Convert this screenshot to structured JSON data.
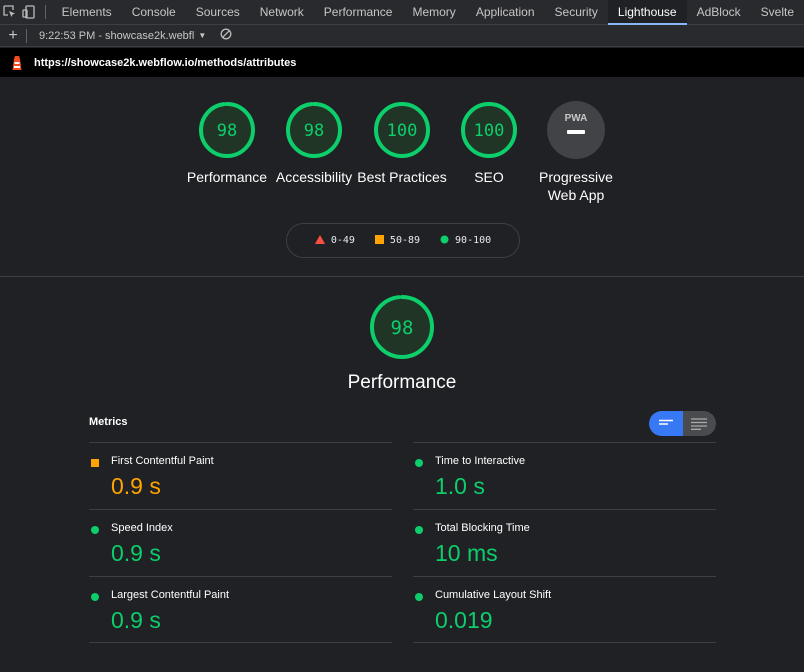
{
  "devtools": {
    "tabs": [
      "Elements",
      "Console",
      "Sources",
      "Network",
      "Performance",
      "Memory",
      "Application",
      "Security",
      "Lighthouse",
      "AdBlock",
      "Svelte"
    ],
    "active_tab": "Lighthouse"
  },
  "toolbar": {
    "report_label": "9:22:53 PM - showcase2k.webfl"
  },
  "url": "https://showcase2k.webflow.io/methods/attributes",
  "categories": [
    {
      "label": "Performance",
      "score": "98"
    },
    {
      "label": "Accessibility",
      "score": "98"
    },
    {
      "label": "Best Practices",
      "score": "100"
    },
    {
      "label": "SEO",
      "score": "100"
    },
    {
      "label": "Progressive Web App",
      "badge": "PWA"
    }
  ],
  "legend": [
    {
      "range": "0-49",
      "shape": "triangle",
      "color": "#ff4e42"
    },
    {
      "range": "50-89",
      "shape": "square",
      "color": "#ffa400"
    },
    {
      "range": "90-100",
      "shape": "circle",
      "color": "#0cce6b"
    }
  ],
  "performance": {
    "score": "98",
    "title": "Performance",
    "metrics_header": "Metrics",
    "metrics": [
      {
        "name": "First Contentful Paint",
        "value": "0.9 s",
        "rating": "average"
      },
      {
        "name": "Time to Interactive",
        "value": "1.0 s",
        "rating": "pass"
      },
      {
        "name": "Speed Index",
        "value": "0.9 s",
        "rating": "pass"
      },
      {
        "name": "Total Blocking Time",
        "value": "10 ms",
        "rating": "pass"
      },
      {
        "name": "Largest Contentful Paint",
        "value": "0.9 s",
        "rating": "pass"
      },
      {
        "name": "Cumulative Layout Shift",
        "value": "0.019",
        "rating": "pass"
      }
    ]
  },
  "colors": {
    "pass": "#0cce6b",
    "average": "#ffa400",
    "fail": "#ff4e42",
    "toggle_active": "#3779f5"
  }
}
